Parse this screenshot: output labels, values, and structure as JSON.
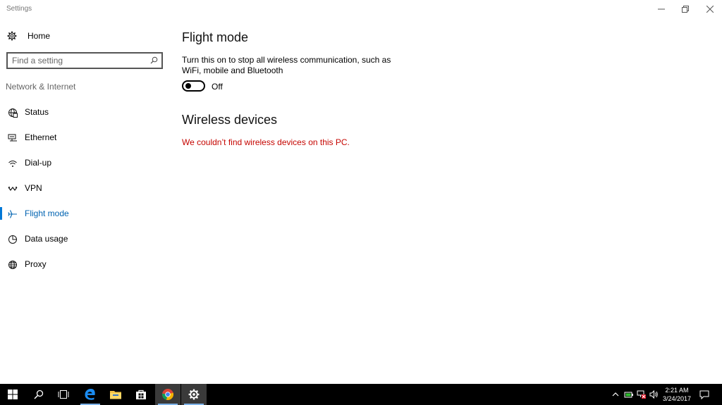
{
  "window": {
    "title": "Settings"
  },
  "sidebar": {
    "home_label": "Home",
    "search_placeholder": "Find a setting",
    "section_label": "Network & Internet",
    "items": [
      {
        "label": "Status",
        "icon": "globe-status-icon"
      },
      {
        "label": "Ethernet",
        "icon": "ethernet-icon"
      },
      {
        "label": "Dial-up",
        "icon": "dialup-icon"
      },
      {
        "label": "VPN",
        "icon": "vpn-icon"
      },
      {
        "label": "Flight mode",
        "icon": "airplane-icon",
        "active": true
      },
      {
        "label": "Data usage",
        "icon": "data-usage-icon"
      },
      {
        "label": "Proxy",
        "icon": "globe-icon"
      }
    ]
  },
  "main": {
    "title": "Flight mode",
    "description": "Turn this on to stop all wireless communication, such as WiFi, mobile and Bluetooth",
    "toggle_state": "Off",
    "toggle_on": false,
    "section_title": "Wireless devices",
    "error_message": "We couldn’t find wireless devices on this PC."
  },
  "taskbar": {
    "time": "2:21 AM",
    "date": "3/24/2017",
    "apps": [
      "start",
      "search",
      "task-view",
      "edge",
      "file-explorer",
      "store",
      "chrome",
      "settings"
    ],
    "active_app": "settings"
  },
  "colors": {
    "accent": "#0078d7",
    "error": "#c50500",
    "taskbar": "#000000"
  }
}
